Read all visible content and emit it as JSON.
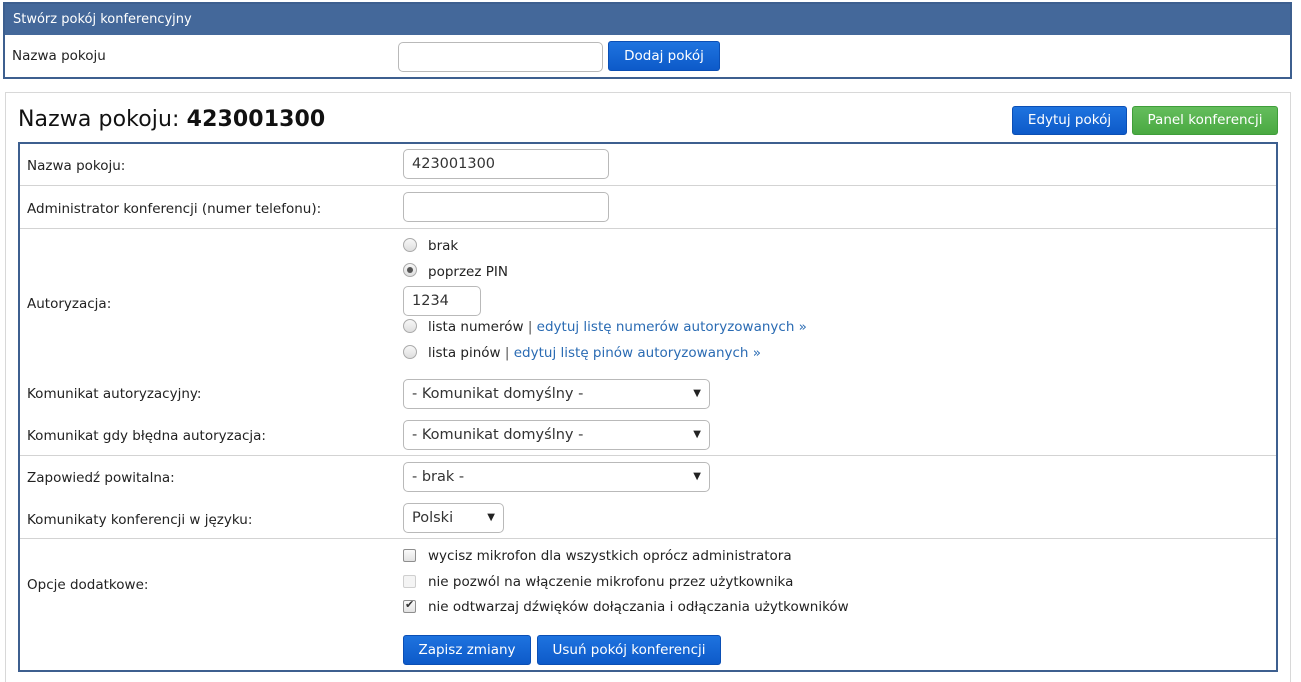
{
  "create": {
    "header": "Stwórz pokój konferencyjny",
    "name_label": "Nazwa pokoju",
    "name_value": "",
    "add_button": "Dodaj pokój"
  },
  "room": {
    "title_prefix": "Nazwa pokoju:",
    "title_name": "423001300",
    "edit_button": "Edytuj pokój",
    "panel_button": "Panel konferencji"
  },
  "form": {
    "room_name_label": "Nazwa pokoju:",
    "room_name_value": "423001300",
    "admin_label": "Administrator konferencji (numer telefonu):",
    "admin_value": "",
    "auth_label": "Autoryzacja:",
    "auth_options": {
      "none": "brak",
      "pin": "poprzez PIN",
      "pin_value": "1234",
      "number_list": "lista numerów",
      "number_list_link": "edytuj listę numerów autoryzowanych »",
      "pin_list": "lista pinów",
      "pin_list_link": "edytuj listę pinów autoryzowanych »",
      "separator": "|",
      "selected": "pin"
    },
    "auth_msg_label": "Komunikat autoryzacyjny:",
    "auth_msg_value": "- Komunikat domyślny -",
    "bad_auth_label": "Komunikat gdy błędna autoryzacja:",
    "bad_auth_value": "- Komunikat domyślny -",
    "welcome_label": "Zapowiedź powitalna:",
    "welcome_value": "- brak -",
    "lang_label": "Komunikaty konferencji w języku:",
    "lang_value": "Polski",
    "extra_label": "Opcje dodatkowe:",
    "extra_options": [
      {
        "label": "wycisz mikrofon dla wszystkich oprócz administratora",
        "checked": false,
        "disabled": false
      },
      {
        "label": "nie pozwól na włączenie mikrofonu przez użytkownika",
        "checked": false,
        "disabled": true
      },
      {
        "label": "nie odtwarzaj dźwięków dołączania i odłączania użytkowników",
        "checked": true,
        "disabled": false
      }
    ],
    "save_button": "Zapisz zmiany",
    "delete_button": "Usuń pokój konferencji"
  },
  "colors": {
    "header_blue": "#44689a",
    "button_blue": "#1366d6",
    "button_green": "#55b24d",
    "link": "#2a6bb3"
  }
}
